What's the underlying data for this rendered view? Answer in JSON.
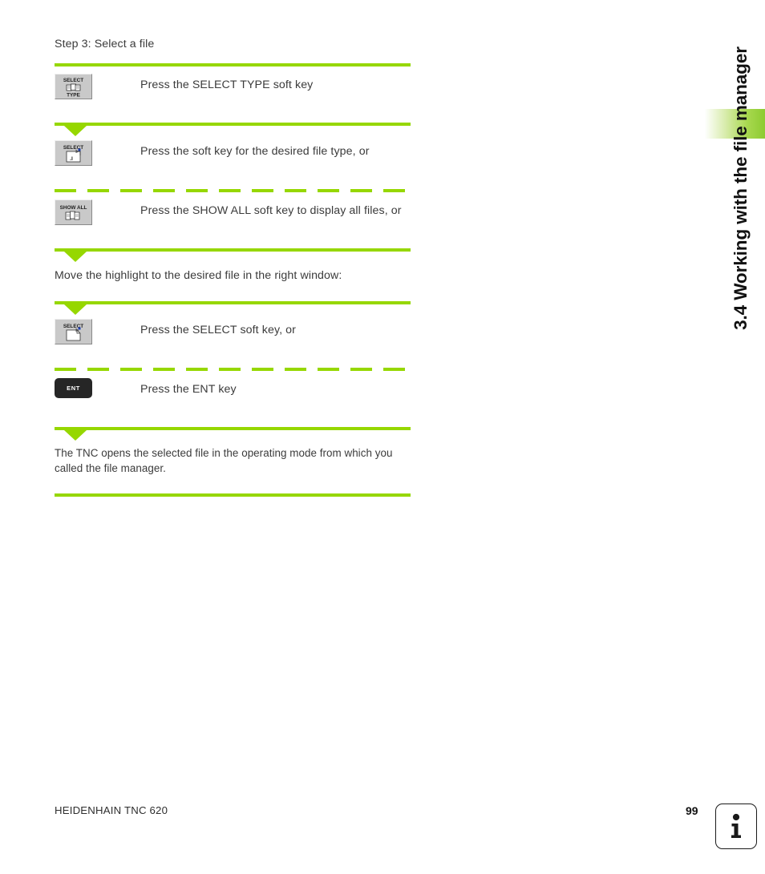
{
  "page": {
    "chapter_tab": "3.4 Working with the file manager",
    "step_heading": "Step 3: Select a file"
  },
  "steps": [
    {
      "key_type": "softkey",
      "key_label_top": "SELECT",
      "key_label_bottom": "TYPE",
      "key_icon": "select-type-icon",
      "text": "Press the SELECT TYPE soft key",
      "separator_above": "solid",
      "arrow_above": false
    },
    {
      "key_type": "softkey",
      "key_label_top": "SELECT",
      "key_label_bottom": "",
      "key_icon": "select-file-type-icon",
      "text": "Press the soft key for the desired file type, or",
      "separator_above": "solid",
      "arrow_above": true
    },
    {
      "key_type": "softkey",
      "key_label_top": "SHOW ALL",
      "key_label_bottom": "",
      "key_icon": "show-all-files-icon",
      "text": "Press the SHOW ALL soft key to display all files, or",
      "separator_above": "dashed",
      "arrow_above": false
    }
  ],
  "middle_paragraph": {
    "text": "Move the highlight to the desired file in the right window:",
    "separator_above": "solid",
    "arrow_above": true
  },
  "steps2": [
    {
      "key_type": "softkey",
      "key_label_top": "SELECT",
      "key_label_bottom": "",
      "key_icon": "select-file-icon",
      "text": "Press the SELECT soft key, or",
      "separator_above": "solid",
      "arrow_above": true
    },
    {
      "key_type": "hardkey",
      "key_label_top": "ENT",
      "key_label_bottom": "",
      "key_icon": "ent-key",
      "text": "Press the ENT key",
      "separator_above": "dashed",
      "arrow_above": false
    }
  ],
  "closing": {
    "text": "The TNC opens the selected file in the operating mode from which you called the file manager.",
    "separator_above": "solid",
    "arrow_above": true,
    "separator_below": "solid"
  },
  "footer": {
    "product": "HEIDENHAIN TNC 620",
    "page_number": "99",
    "info_icon": "information-icon"
  },
  "colors": {
    "accent_green": "#96d700",
    "softkey_gray": "#c9c9c9",
    "hardkey_black": "#262626",
    "text": "#3b3b3b"
  }
}
